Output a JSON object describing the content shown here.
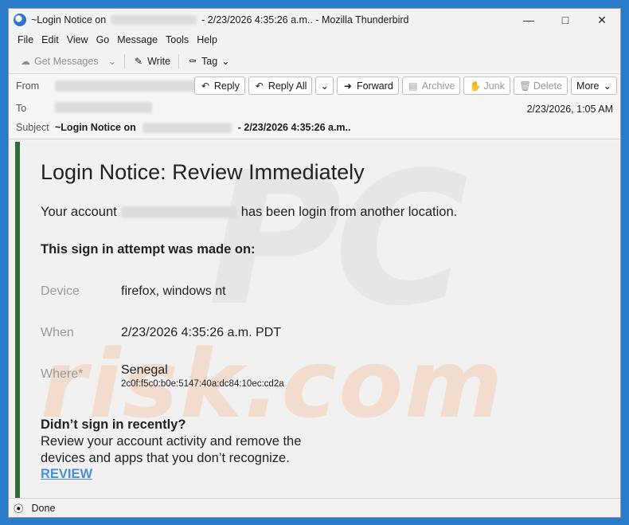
{
  "titlebar": {
    "prefix": "~Login Notice on",
    "suffix": "- 2/23/2026 4:35:26 a.m.. - Mozilla Thunderbird"
  },
  "menu": [
    "File",
    "Edit",
    "View",
    "Go",
    "Message",
    "Tools",
    "Help"
  ],
  "toolbar": {
    "get_messages": "Get Messages",
    "write": "Write",
    "tag": "Tag"
  },
  "header": {
    "from_label": "From",
    "to_label": "To",
    "subject_label": "Subject",
    "subject_prefix": "~Login Notice on",
    "subject_suffix": "- 2/23/2026 4:35:26 a.m..",
    "date": "2/23/2026, 1:05 AM",
    "buttons": {
      "reply": "Reply",
      "reply_all": "Reply All",
      "forward": "Forward",
      "archive": "Archive",
      "junk": "Junk",
      "delete": "Delete",
      "more": "More"
    }
  },
  "email": {
    "heading": "Login Notice: Review Immediately",
    "intro_prefix": "Your account",
    "intro_suffix": "has been login from another location.",
    "attempt_heading": "This sign in attempt was made on:",
    "device_label": "Device",
    "device_value": "firefox, windows nt",
    "when_label": "When",
    "when_value": "2/23/2026 4:35:26 a.m. PDT",
    "where_label": "Where*",
    "where_value": "Senegal",
    "ip": "2c0f:f5c0:b0e:5147:40a:dc84:10ec:cd2a",
    "not_you": "Didn’t sign in recently?",
    "body_line1": "Review your account activity and remove the",
    "body_line2": "devices and apps that you don’t recognize.",
    "review_link": "REVIEW"
  },
  "watermark": {
    "top": "PC",
    "bottom": "risk.com"
  },
  "status": {
    "text": "Done"
  }
}
